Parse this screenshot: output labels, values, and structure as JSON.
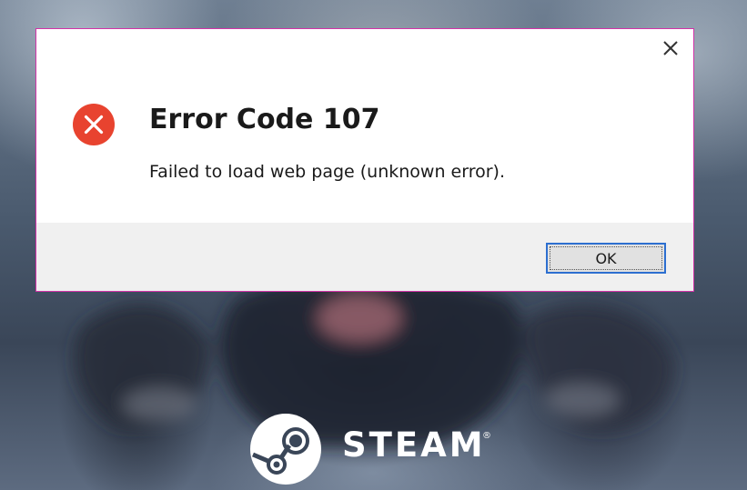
{
  "dialog": {
    "title": "Error Code 107",
    "message": "Failed to load web page (unknown error).",
    "ok_label": "OK",
    "close_icon": "close-icon",
    "status_icon": "error-icon",
    "border_color": "#d233a8",
    "accent_color": "#2d6fd0",
    "error_color": "#e8432f"
  },
  "branding": {
    "wordmark": "STEAM",
    "registered_mark": "®",
    "logo_icon": "steam-logo-icon"
  }
}
